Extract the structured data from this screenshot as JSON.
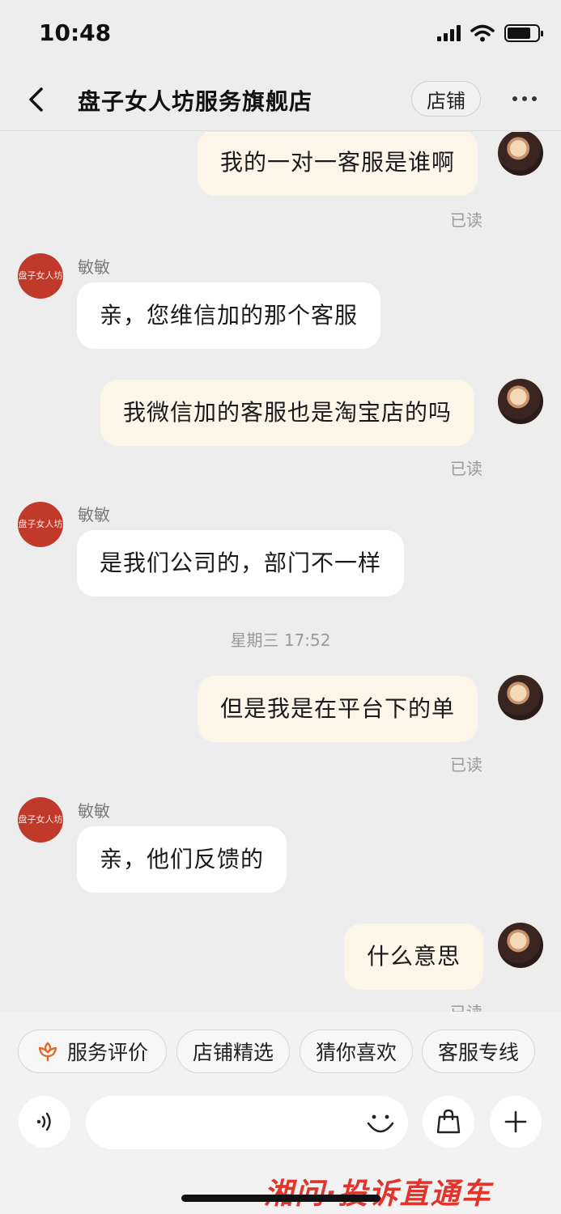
{
  "status_bar": {
    "time": "10:48"
  },
  "nav": {
    "title": "盘子女人坊服务旗舰店",
    "store_button": "店铺"
  },
  "shop_avatar_text": "盘子女人坊",
  "messages": [
    {
      "from": "me",
      "text": "我的一对一客服是谁啊",
      "status": "已读"
    },
    {
      "from": "them",
      "sender": "敏敏",
      "text": "亲，您维信加的那个客服"
    },
    {
      "from": "me",
      "text": "我微信加的客服也是淘宝店的吗",
      "status": "已读"
    },
    {
      "from": "them",
      "sender": "敏敏",
      "text": "是我们公司的，部门不一样"
    },
    {
      "from": "me",
      "text": "但是我是在平台下的单",
      "status": "已读"
    },
    {
      "from": "them",
      "sender": "敏敏",
      "text": "亲，他们反馈的"
    },
    {
      "from": "me",
      "text": "什么意思",
      "status": "已读"
    }
  ],
  "timestamp": "星期三 17:52",
  "quick_tags": [
    {
      "label": "服务评价",
      "icon": "flower-icon"
    },
    {
      "label": "店铺精选"
    },
    {
      "label": "猜你喜欢"
    },
    {
      "label": "客服专线"
    }
  ],
  "input": {
    "placeholder": ""
  },
  "watermark": "湘问·投诉直通车",
  "colors": {
    "accent": "#e06a2c",
    "my_bubble": "#fbf6e8",
    "their_bubble": "#ffffff",
    "watermark": "#e0342c"
  }
}
